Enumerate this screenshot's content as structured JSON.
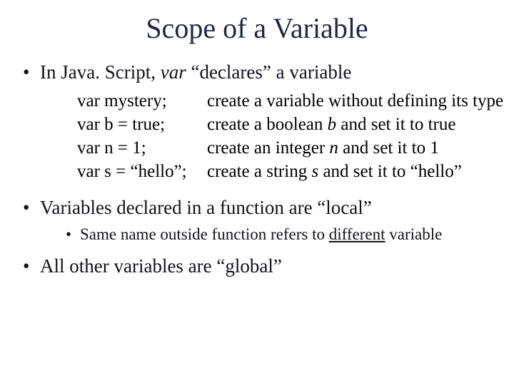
{
  "title": "Scope of a Variable",
  "bullets": {
    "b1_pre": "In Java. Script, ",
    "b1_var": "var",
    "b1_post": " “declares” a variable",
    "b2": "Variables declared in a function are “local”",
    "b2_sub_pre": "Same name outside function refers to ",
    "b2_sub_u": "different",
    "b2_sub_post": " variable",
    "b3": "All other variables are “global”"
  },
  "examples": {
    "r0": {
      "code": "var mystery;",
      "desc": "create a variable without defining its type"
    },
    "r1": {
      "code": "var b = true;",
      "desc_pre": "create a boolean ",
      "desc_i": "b",
      "desc_post": " and set it to true"
    },
    "r2": {
      "code": "var n = 1;",
      "desc_pre": "create an integer ",
      "desc_i": "n",
      "desc_post": " and set it to 1"
    },
    "r3": {
      "code": "var s = “hello”;",
      "desc_pre": "create a string ",
      "desc_i": "s",
      "desc_post": " and set it to “hello”"
    }
  }
}
